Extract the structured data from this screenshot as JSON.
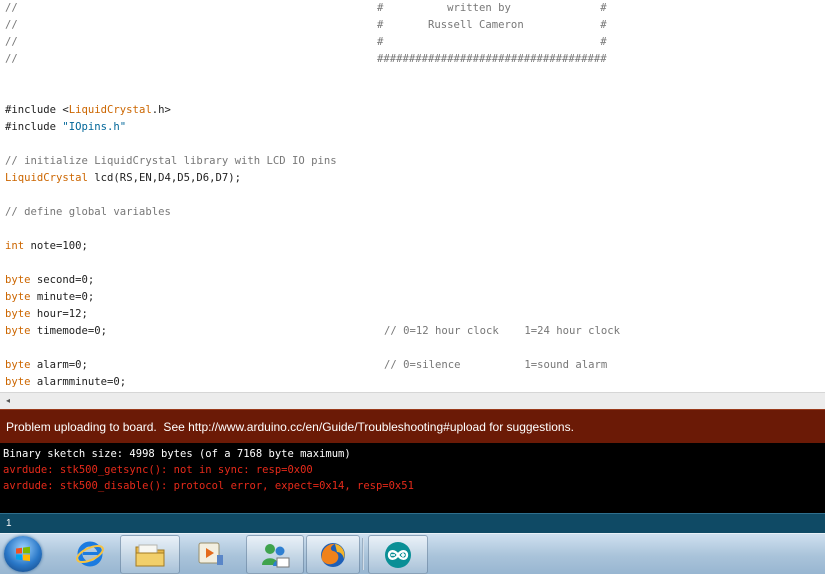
{
  "editor": {
    "lines": [
      {
        "code": "//",
        "trail": "#          written by              #"
      },
      {
        "code": "//",
        "trail": "#       Russell Cameron            #"
      },
      {
        "code": "//",
        "trail": "#                                  #"
      },
      {
        "code": "//",
        "trail": "####################################"
      },
      {
        "code": "#include <",
        "kw": "LiquidCrystal",
        "rest": ".h>"
      },
      {
        "code": "#include ",
        "str": "\"IOpins.h\""
      },
      {
        "comment": "// initialize LiquidCrystal library with LCD IO pins"
      },
      {
        "kw": "LiquidCrystal",
        "rest": " lcd(RS,EN,D4,D5,D6,D7);"
      },
      {
        "comment": "// define global variables"
      },
      {
        "kw": "int",
        "rest": " note=100;"
      },
      {
        "kw": "byte",
        "rest": " second=0;"
      },
      {
        "kw": "byte",
        "rest": " minute=0;"
      },
      {
        "kw": "byte",
        "rest": " hour=12;"
      },
      {
        "kw": "byte",
        "rest": " timemode=0;",
        "trail": "// 0=12 hour clock    1=24 hour clock"
      },
      {
        "kw": "byte",
        "rest": " alarm=0;",
        "trail": "// 0=silence          1=sound alarm"
      },
      {
        "kw": "byte",
        "rest": " alarmminute=0;"
      }
    ]
  },
  "scrollbar": {
    "left_arrow": "◂"
  },
  "status": {
    "message": "Problem uploading to board.  See http://www.arduino.cc/en/Guide/Troubleshooting#upload for suggestions."
  },
  "console": {
    "lines": [
      {
        "text": "Binary sketch size: 4998 bytes (of a 7168 byte maximum)",
        "kind": "info"
      },
      {
        "text": "avrdude: stk500_getsync(): not in sync: resp=0x00",
        "kind": "error"
      },
      {
        "text": "avrdude: stk500_disable(): protocol error, expect=0x14, resp=0x51",
        "kind": "error"
      }
    ]
  },
  "line_indicator": "1",
  "taskbar": {
    "items": [
      {
        "name": "start-button",
        "icon": "windows-start-orb"
      },
      {
        "name": "taskbar-internet-explorer",
        "icon": "internet-explorer-icon"
      },
      {
        "name": "taskbar-windows-explorer",
        "icon": "folder-icon"
      },
      {
        "name": "taskbar-media-player",
        "icon": "media-player-icon"
      },
      {
        "name": "taskbar-messenger",
        "icon": "messenger-icon"
      },
      {
        "name": "taskbar-firefox",
        "icon": "firefox-icon"
      },
      {
        "name": "taskbar-arduino",
        "icon": "arduino-icon"
      }
    ]
  },
  "colors": {
    "keyword": "#cc6600",
    "string": "#006699",
    "comment": "#777777",
    "status_bar": "#6b1a06",
    "console_error": "#e62a1a",
    "line_strip": "#0f4a65"
  }
}
